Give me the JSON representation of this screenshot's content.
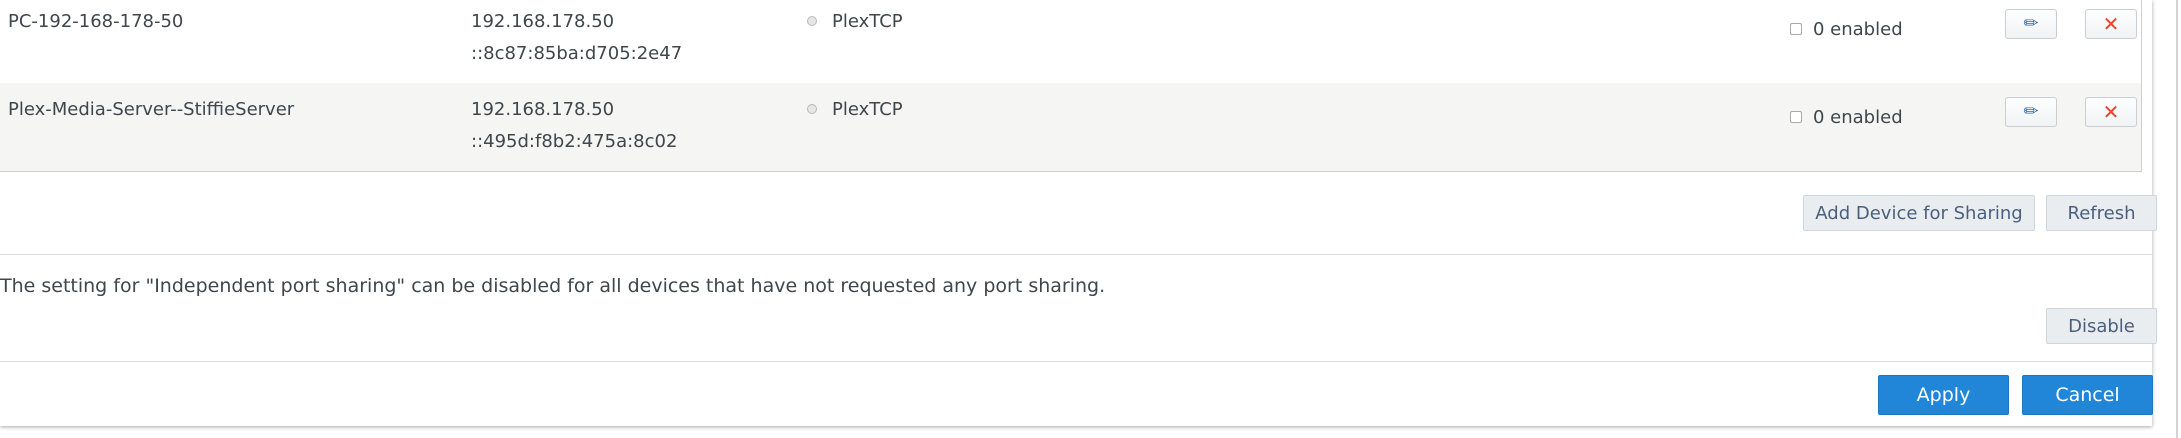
{
  "devices": [
    {
      "name": "PC-192-168-178-50",
      "ipv4": "192.168.178.50",
      "ipv6": "::8c87:85ba:d705:2e47",
      "service": "PlexTCP",
      "enabled_label": "0 enabled"
    },
    {
      "name": "Plex-Media-Server--StiffieServer",
      "ipv4": "192.168.178.50",
      "ipv6": "::495d:f8b2:475a:8c02",
      "service": "PlexTCP",
      "enabled_label": "0 enabled"
    }
  ],
  "actions": {
    "add_device_label": "Add Device for Sharing",
    "refresh_label": "Refresh"
  },
  "independent_sharing": {
    "info_text": "The setting for \"Independent port sharing\" can be disabled for all devices that have not requested any port sharing.",
    "disable_label": "Disable"
  },
  "footer": {
    "apply_label": "Apply",
    "cancel_label": "Cancel"
  },
  "colors": {
    "primary": "#2185d8",
    "row_alt": "#f5f5f3",
    "delete_icon": "#e8452c",
    "edit_icon": "#3a69a8"
  },
  "icons": {
    "edit": "pencil-icon",
    "delete": "close-icon",
    "status": "status-dot-icon"
  }
}
